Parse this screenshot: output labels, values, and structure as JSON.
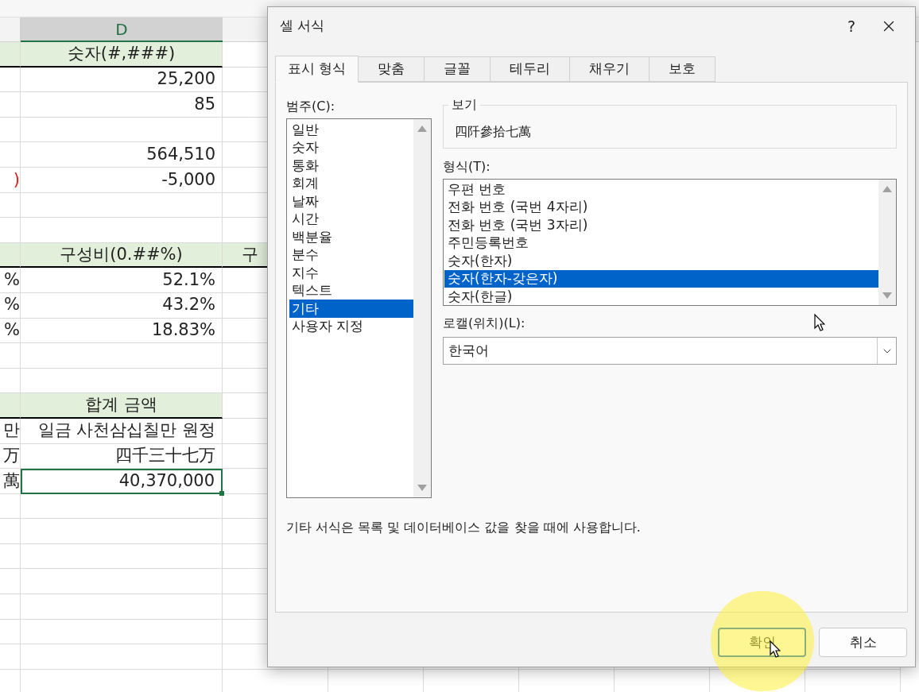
{
  "sheet": {
    "column_header": "D",
    "rows": [
      {
        "kind": "header",
        "d": "숫자(#,###)",
        "selected": false
      },
      {
        "kind": "value",
        "d": "25,200",
        "selected": false
      },
      {
        "kind": "value",
        "d": "85",
        "selected": false
      },
      {
        "kind": "value",
        "selected": false
      },
      {
        "kind": "value",
        "d": "564,510",
        "selected": false
      },
      {
        "kind": "value",
        "c": ")",
        "d": "-5,000",
        "selected": false,
        "c_negative": true
      },
      {
        "kind": "value",
        "selected": false
      },
      {
        "kind": "value",
        "selected": false
      },
      {
        "kind": "header",
        "d": "구성비(0.##%)",
        "e": "구",
        "e_header": true,
        "selected": false
      },
      {
        "kind": "value",
        "c": "%",
        "d": "52.1%",
        "selected": false,
        "c_negative": false
      },
      {
        "kind": "value",
        "c": "%",
        "d": "43.2%",
        "selected": false,
        "c_negative": false
      },
      {
        "kind": "value",
        "c": "%",
        "d": "18.83%",
        "selected": false,
        "c_negative": false
      },
      {
        "kind": "value",
        "selected": false
      },
      {
        "kind": "value",
        "selected": false
      },
      {
        "kind": "header",
        "d": "합계 금액",
        "selected": false
      },
      {
        "kind": "value",
        "c": "만",
        "d": "일금 사천삼십칠만 원정",
        "selected": false,
        "c_negative": false
      },
      {
        "kind": "value",
        "c": "万",
        "d": "四千三十七万",
        "selected": false,
        "c_negative": false
      },
      {
        "kind": "value",
        "c": "萬",
        "d": "40,370,000",
        "selected": true,
        "c_negative": false
      }
    ]
  },
  "dialog": {
    "title": "셀 서식",
    "help": "?",
    "tabs": [
      {
        "label": "표시 형식",
        "selected": true
      },
      {
        "label": "맞춤",
        "selected": false
      },
      {
        "label": "글꼴",
        "selected": false
      },
      {
        "label": "테두리",
        "selected": false
      },
      {
        "label": "채우기",
        "selected": false
      },
      {
        "label": "보호",
        "selected": false
      }
    ],
    "category": {
      "label": "범주(C):",
      "items": [
        {
          "label": "일반",
          "selected": false
        },
        {
          "label": "숫자",
          "selected": false
        },
        {
          "label": "통화",
          "selected": false
        },
        {
          "label": "회계",
          "selected": false
        },
        {
          "label": "날짜",
          "selected": false
        },
        {
          "label": "시간",
          "selected": false
        },
        {
          "label": "백분율",
          "selected": false
        },
        {
          "label": "분수",
          "selected": false
        },
        {
          "label": "지수",
          "selected": false
        },
        {
          "label": "텍스트",
          "selected": false
        },
        {
          "label": "기타",
          "selected": true
        },
        {
          "label": "사용자 지정",
          "selected": false
        }
      ]
    },
    "sample": {
      "label": "보기",
      "value": "四阡參拾七萬"
    },
    "format": {
      "label": "형식(T):",
      "items": [
        {
          "label": "우편 번호",
          "selected": false
        },
        {
          "label": "전화 번호 (국번 4자리)",
          "selected": false
        },
        {
          "label": "전화 번호 (국번 3자리)",
          "selected": false
        },
        {
          "label": "주민등록번호",
          "selected": false
        },
        {
          "label": "숫자(한자)",
          "selected": false
        },
        {
          "label": "숫자(한자-갖은자)",
          "selected": true
        },
        {
          "label": "숫자(한글)",
          "selected": false
        }
      ]
    },
    "locale": {
      "label": "로캘(위치)(L):",
      "value": "한국어"
    },
    "description": "기타 서식은 목록 및 데이터베이스 값을 찾을 때에 사용합니다.",
    "buttons": [
      {
        "label": "확인",
        "kind": "primary"
      },
      {
        "label": "취소",
        "kind": "secondary"
      }
    ]
  }
}
